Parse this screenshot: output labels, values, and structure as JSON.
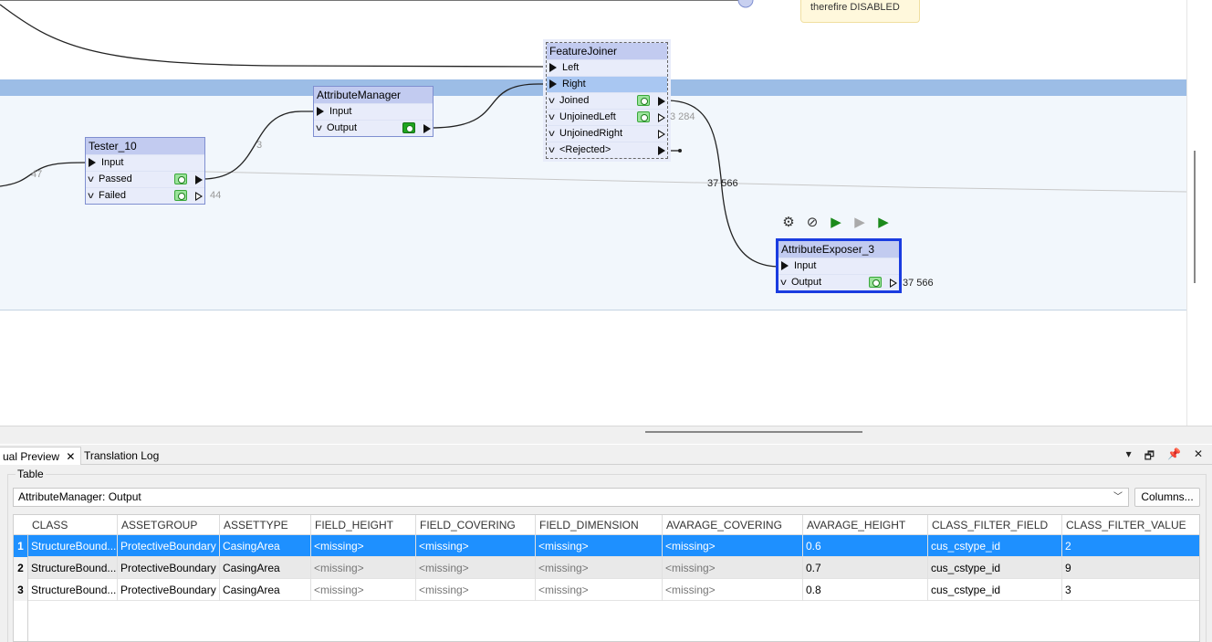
{
  "canvas": {
    "annotation_text": "therefire DISABLED",
    "transformers": {
      "tester": {
        "title": "Tester_10",
        "ports": {
          "input": "Input",
          "passed": "Passed",
          "failed": "Failed"
        }
      },
      "attribute_manager": {
        "title": "AttributeManager",
        "ports": {
          "input": "Input",
          "output": "Output"
        }
      },
      "feature_joiner": {
        "title": "FeatureJoiner",
        "ports": {
          "left": "Left",
          "right": "Right",
          "joined": "Joined",
          "unjoined_left": "UnjoinedLeft",
          "unjoined_right": "UnjoinedRight",
          "rejected": "<Rejected>"
        }
      },
      "attribute_exposer": {
        "title": "AttributeExposer_3",
        "ports": {
          "input": "Input",
          "output": "Output"
        }
      }
    },
    "counts": {
      "tester_in": "47",
      "tester_failed": "44",
      "tester_passed": "3",
      "unjoined_left": "3 284",
      "joined": "37 566",
      "exposer_output": "37 566"
    },
    "mini_toolbar_icons": [
      "gear-icon",
      "disable-icon",
      "run-icon",
      "run-disabled-icon",
      "run-to-icon"
    ]
  },
  "panel": {
    "tabs": [
      "ual Preview",
      "Translation Log"
    ],
    "group_label": "Table",
    "selected_source": "AttributeManager: Output",
    "columns_button": "Columns...",
    "table": {
      "columns": [
        "CLASS",
        "ASSETGROUP",
        "ASSETTYPE",
        "FIELD_HEIGHT",
        "FIELD_COVERING",
        "FIELD_DIMENSION",
        "AVARAGE_COVERING",
        "AVARAGE_HEIGHT",
        "CLASS_FILTER_FIELD",
        "CLASS_FILTER_VALUE"
      ],
      "rows": [
        {
          "n": "1",
          "cells": [
            "StructureBound...",
            "ProtectiveBoundary",
            "CasingArea",
            "<missing>",
            "<missing>",
            "<missing>",
            "<missing>",
            "0.6",
            "cus_cstype_id",
            "2"
          ]
        },
        {
          "n": "2",
          "cells": [
            "StructureBound...",
            "ProtectiveBoundary",
            "CasingArea",
            "<missing>",
            "<missing>",
            "<missing>",
            "<missing>",
            "0.7",
            "cus_cstype_id",
            "9"
          ]
        },
        {
          "n": "3",
          "cells": [
            "StructureBound...",
            "ProtectiveBoundary",
            "CasingArea",
            "<missing>",
            "<missing>",
            "<missing>",
            "<missing>",
            "0.8",
            "cus_cstype_id",
            "3"
          ]
        }
      ]
    }
  }
}
